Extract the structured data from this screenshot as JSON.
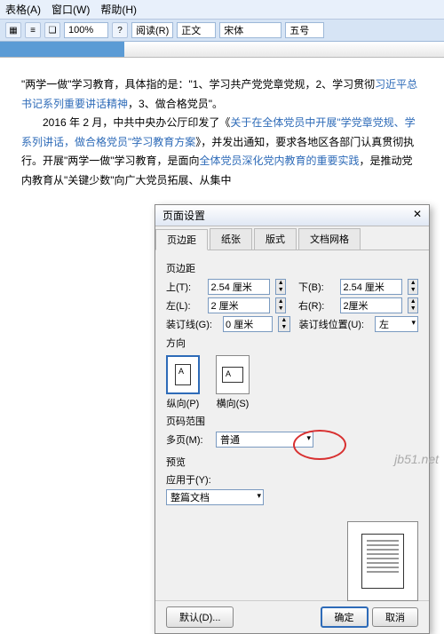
{
  "menu": {
    "table": "表格(A)",
    "window": "窗口(W)",
    "help": "帮助(H)"
  },
  "toolbar": {
    "zoom": "100%",
    "read": "阅读(R)",
    "style": "正文",
    "font": "宋体",
    "size": "五号"
  },
  "doc": {
    "p1a": "\"两学一做\"学习教育，具体指的是：\"1、学习共产党党章党规，2、学习贯彻",
    "p1b": "习近平总书记系列重要讲话精神",
    "p1c": "，3、做合格党员\"。",
    "p2a": "2016 年 2 月，中共中央办公厅印发了《",
    "p2b": "关于在全体党员中开展\"学党章党规、学系列讲话，做合格党员\"学习教育方案",
    "p2c": "》，并发出通知，要求各地区各部门认真贯彻执行。开展\"两学一做\"学习教育，是面向",
    "p2d": "全体党员深化党内教育的重要实践",
    "p2e": "，是推动党内教育从\"关键少数\"向广大党员拓展、从集中"
  },
  "dialog": {
    "title": "页面设置",
    "close": "✕",
    "tabs": {
      "margin": "页边距",
      "paper": "纸张",
      "layout": "版式",
      "grid": "文档网格"
    },
    "marginLabel": "页边距",
    "top": {
      "label": "上(T):",
      "val": "2.54 厘米"
    },
    "bottom": {
      "label": "下(B):",
      "val": "2.54 厘米"
    },
    "left": {
      "label": "左(L):",
      "val": "2 厘米"
    },
    "right": {
      "label": "右(R):",
      "val": "2厘米"
    },
    "gutter": {
      "label": "装订线(G):",
      "val": "0 厘米"
    },
    "gutterPos": {
      "label": "装订线位置(U):",
      "val": "左"
    },
    "orientLabel": "方向",
    "portrait": "纵向(P)",
    "landscape": "横向(S)",
    "rangeLabel": "页码范围",
    "multi": {
      "label": "多页(M):",
      "val": "普通"
    },
    "previewLabel": "预览",
    "apply": {
      "label": "应用于(Y):",
      "val": "整篇文档"
    },
    "default": "默认(D)...",
    "ok": "确定",
    "cancel": "取消"
  },
  "watermark": "jb51.net"
}
